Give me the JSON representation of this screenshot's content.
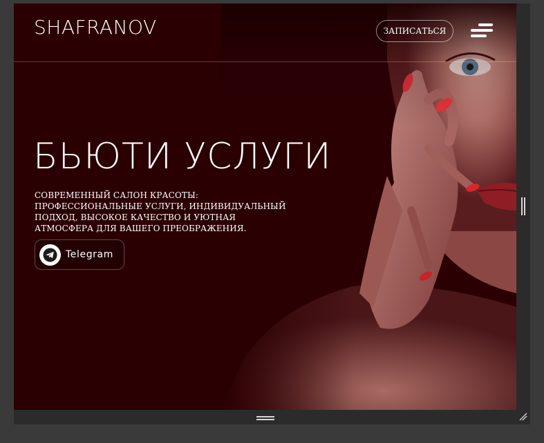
{
  "header": {
    "logo": "SHAFRANOV",
    "book_button": "ЗАПИСАТЬСЯ",
    "menu_icon": "hamburger-menu-icon"
  },
  "hero": {
    "title": "БЬЮТИ  УСЛУГИ",
    "description": "СОВРЕМЕННЫЙ САЛОН КРАСОТЫ: ПРОФЕССИОНАЛЬНЫЕ УСЛУГИ, ИНДИВИДУАЛЬНЫЙ ПОДХОД, ВЫСОКОЕ КАЧЕСТВО И УЮТНАЯ АТМОСФЕРА ДЛЯ ВАШЕГО ПРЕОБРАЖЕНИЯ.",
    "telegram_button": "Telegram",
    "telegram_icon": "telegram-icon"
  },
  "colors": {
    "background": "#2b0003",
    "text": "#ffffff",
    "accent_nails": "#d8262e"
  }
}
